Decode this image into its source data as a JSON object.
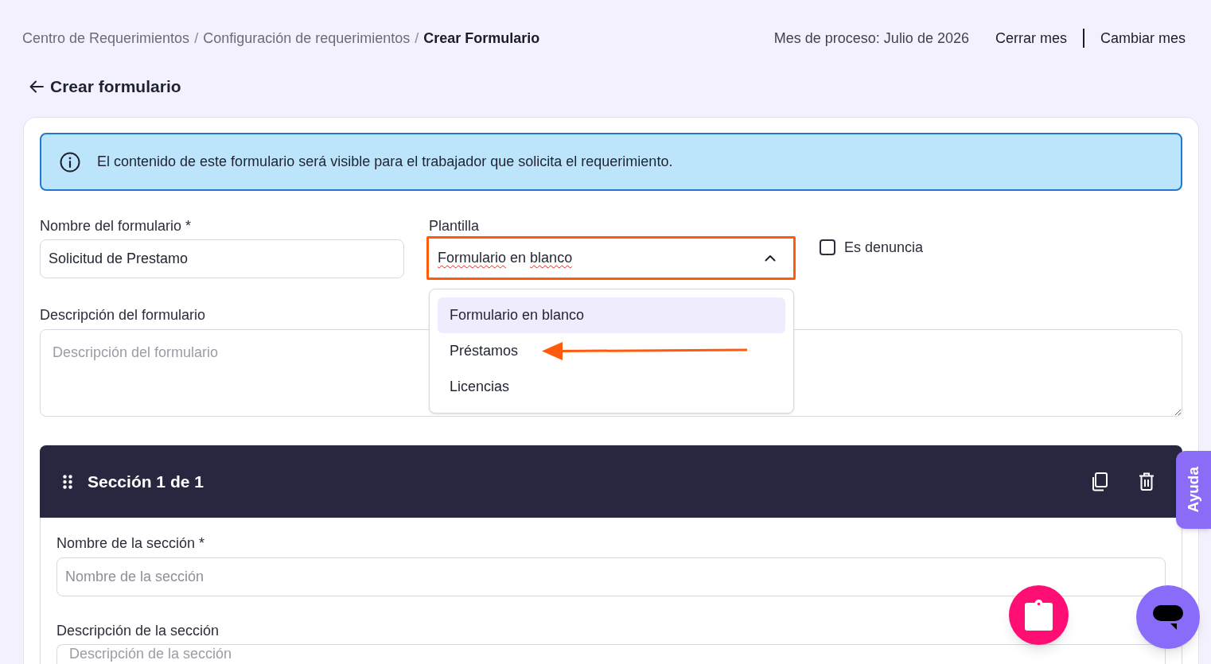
{
  "breadcrumb": [
    {
      "kind": "link",
      "label": "Centro de Requerimientos"
    },
    {
      "kind": "separator",
      "label": "/"
    },
    {
      "kind": "link",
      "label": "Configuración de requerimientos"
    },
    {
      "kind": "separator",
      "label": "/"
    },
    {
      "kind": "current",
      "label": "Crear Formulario"
    }
  ],
  "header": {
    "process_month": "Mes de proceso: Julio de 2026",
    "actions": [
      "Cerrar mes",
      "Cambiar mes"
    ]
  },
  "page_title": "Crear formulario",
  "notice": "El contenido de este formulario será visible para el trabajador que solicita el requerimiento.",
  "form": {
    "name_field": {
      "label": "Nombre del formulario *",
      "value": "Solicitud de Prestamo"
    },
    "template_field": {
      "label": "Plantilla",
      "value": "Formulario en blanco",
      "spellcheck_flags": [
        true,
        false,
        true
      ],
      "expanded": true,
      "annotated": true,
      "options": [
        {
          "label": "Formulario en blanco",
          "selected": true,
          "annotated": false
        },
        {
          "label": "Préstamos",
          "selected": false,
          "annotated": true
        },
        {
          "label": "Licencias",
          "selected": false,
          "annotated": false
        }
      ]
    },
    "complaint_checkbox": {
      "label": "Es denuncia",
      "checked": false
    },
    "description_field": {
      "label": "Descripción del formulario",
      "placeholder": "Descripción del formulario"
    }
  },
  "section": {
    "title": "Sección 1 de 1",
    "name_field": {
      "label": "Nombre de la sección *",
      "placeholder": "Nombre de la sección"
    },
    "description_field": {
      "label": "Descripción de la sección",
      "placeholder": "Descripción de la sección"
    }
  },
  "help_tab": {
    "label": "Ayuda"
  }
}
